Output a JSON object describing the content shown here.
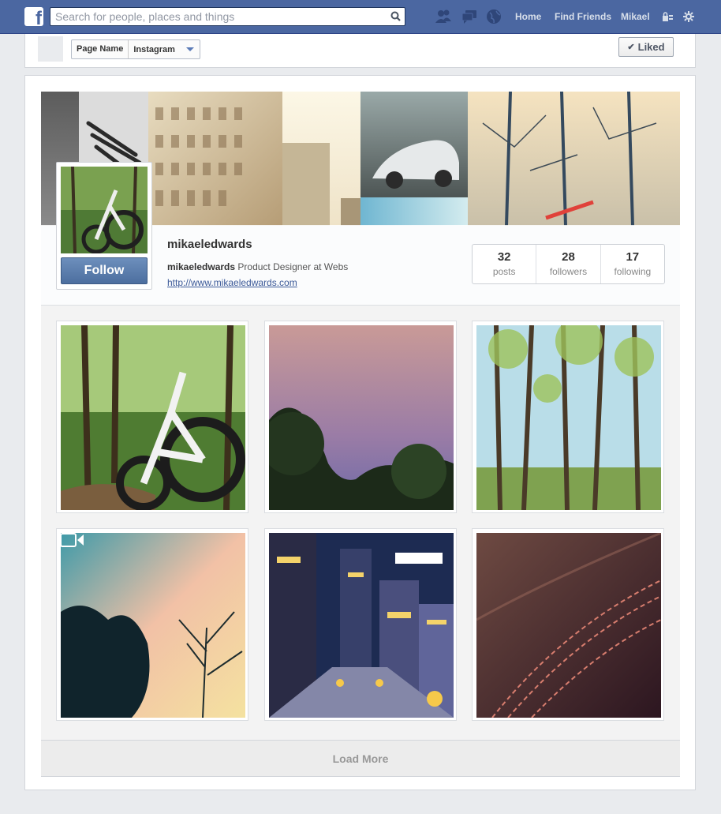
{
  "topbar": {
    "logo": "f",
    "search_placeholder": "Search for people, places and things",
    "nav": [
      "Home",
      "Find Friends",
      "Mikael"
    ],
    "icons": [
      "friend-requests-icon",
      "messages-icon",
      "notifications-globe-icon",
      "privacy-shortcuts-icon",
      "settings-gear-icon"
    ]
  },
  "pagebar": {
    "page_name": "Page Name",
    "app_name": "Instagram",
    "liked_label": "Liked",
    "check_glyph": "✔"
  },
  "profile": {
    "username": "mikaeledwards",
    "bio_name": "mikaeledwards",
    "bio_text": "Product Designer at Webs",
    "website": "http://www.mikaeledwards.com",
    "follow_label": "Follow"
  },
  "stats": [
    {
      "value": "32",
      "label": "posts"
    },
    {
      "value": "28",
      "label": "followers"
    },
    {
      "value": "17",
      "label": "following"
    }
  ],
  "photos": [
    {
      "subject": "mountain bike in forest",
      "video": false
    },
    {
      "subject": "pink cloudy sky over trees",
      "video": false
    },
    {
      "subject": "tall trees against blue sky",
      "video": false
    },
    {
      "subject": "sunset sky with tree silhouettes",
      "video": true
    },
    {
      "subject": "city street at night",
      "video": false
    },
    {
      "subject": "stitched leather close-up",
      "video": false
    }
  ],
  "load_more": "Load More",
  "colors": {
    "brand": "#4b67a1",
    "link": "#3b5998",
    "follow": "#5a7cab"
  }
}
